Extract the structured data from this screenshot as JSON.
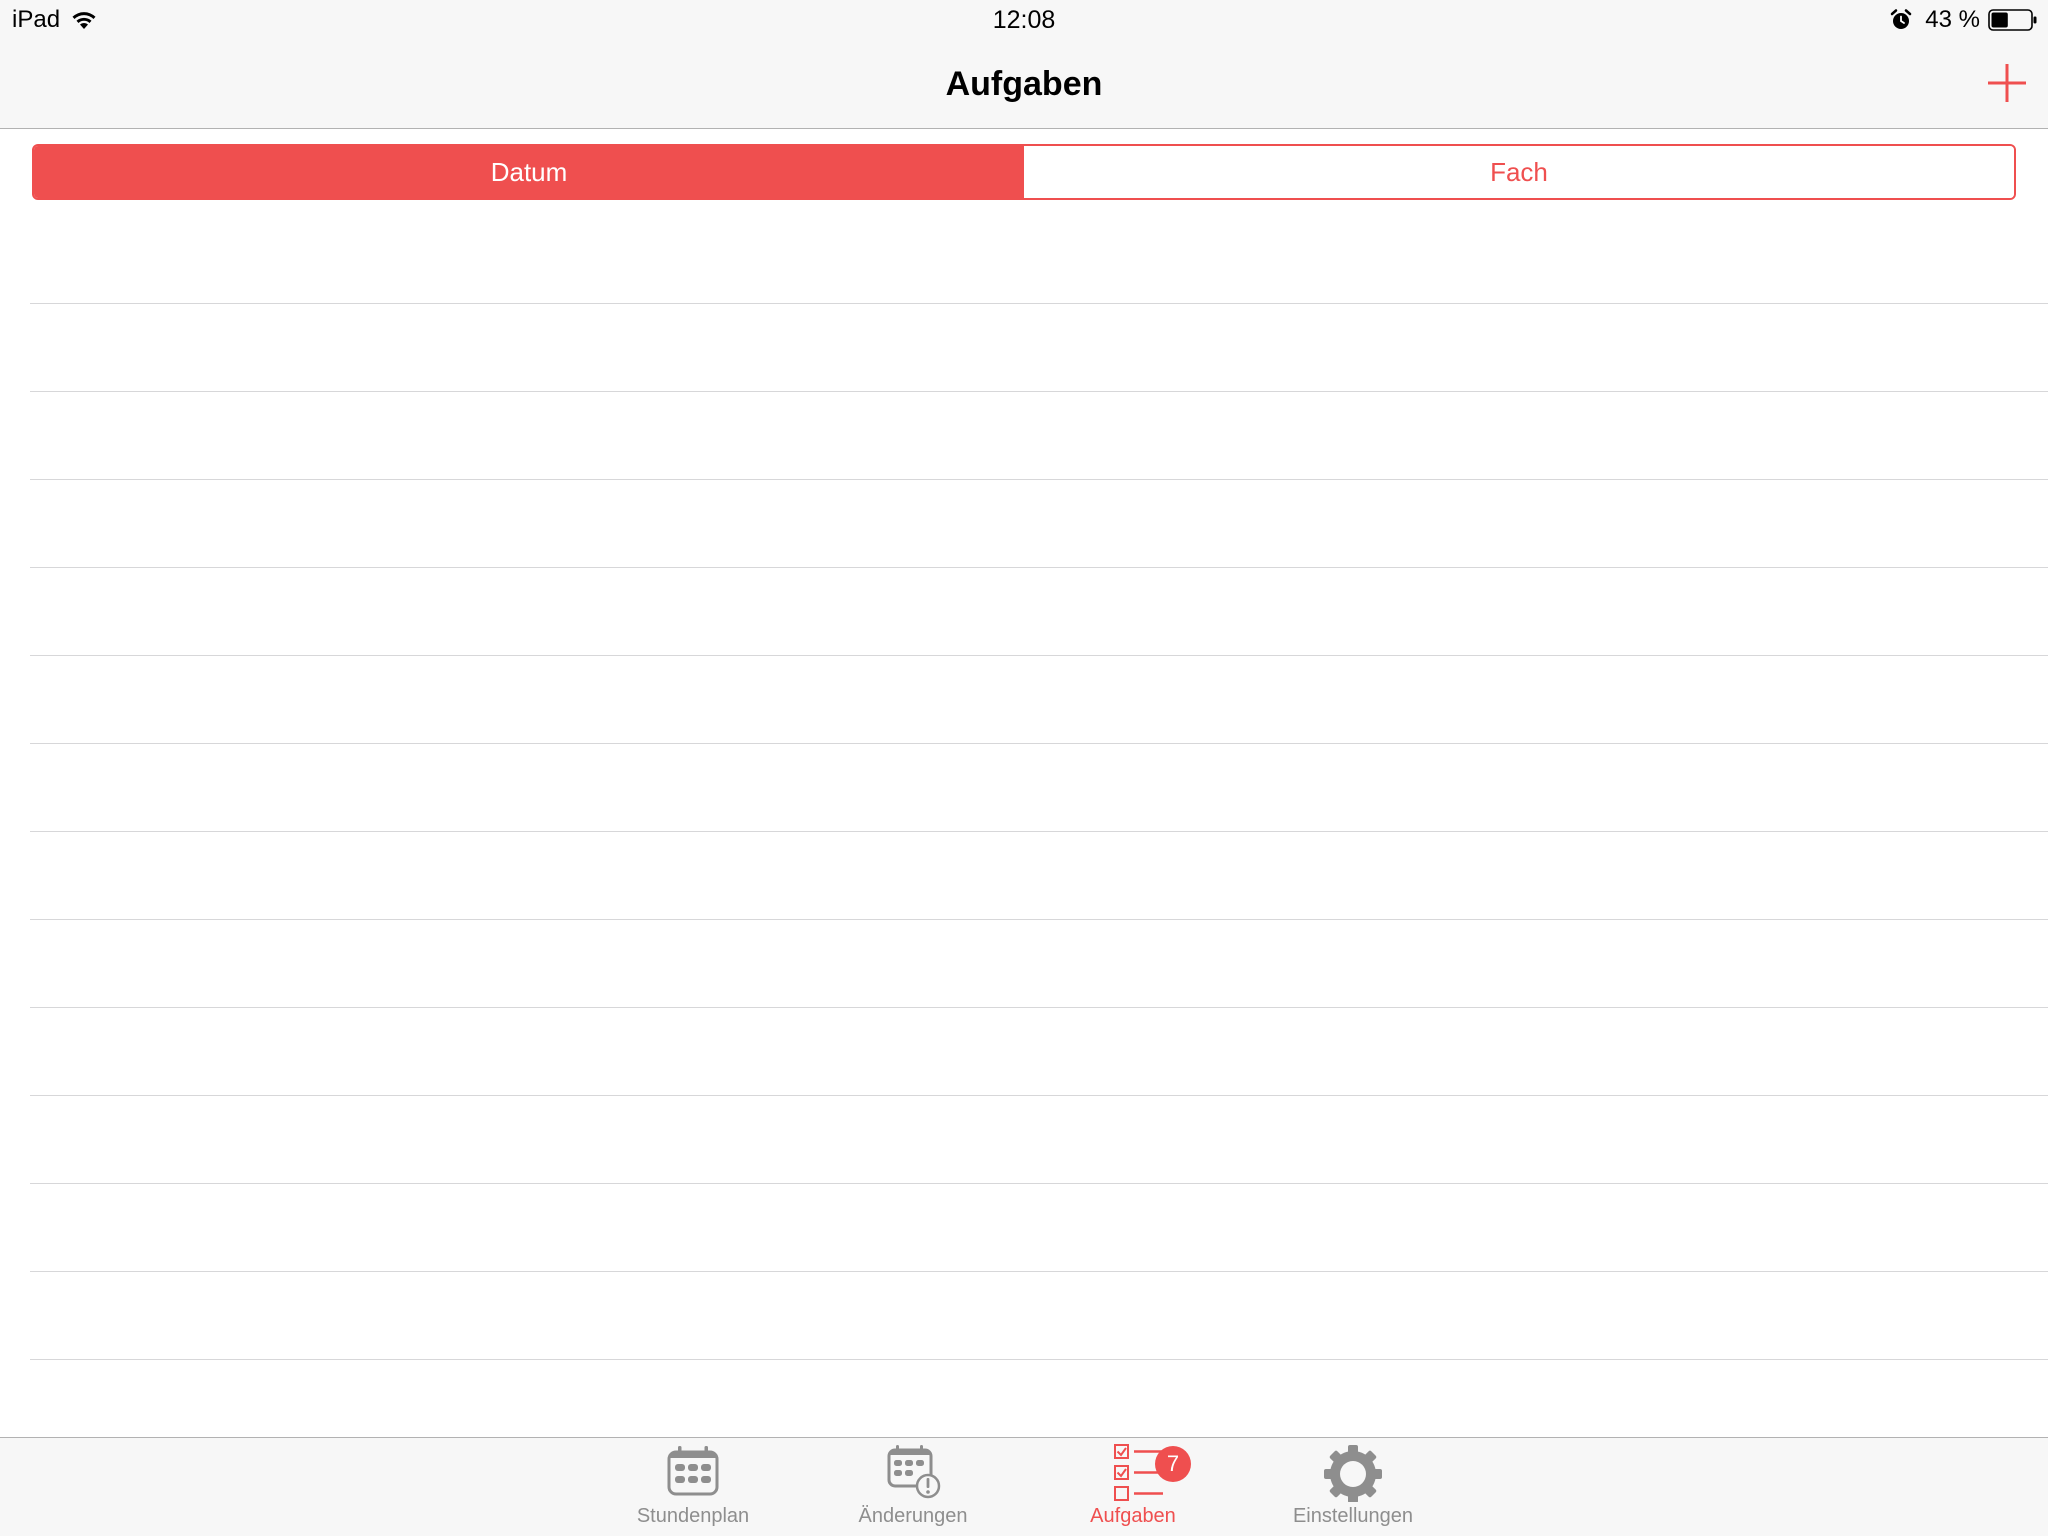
{
  "status_bar": {
    "device": "iPad",
    "time": "12:08",
    "battery": "43 %",
    "battery_level": 0.43
  },
  "nav_bar": {
    "title": "Aufgaben",
    "add_icon": "plus-icon"
  },
  "segmented_control": {
    "segments": [
      {
        "label": "Datum",
        "selected": true
      },
      {
        "label": "Fach",
        "selected": false
      }
    ]
  },
  "tab_bar": {
    "tabs": [
      {
        "label": "Stundenplan",
        "icon": "calendar-grid-icon",
        "selected": false
      },
      {
        "label": "Änderungen",
        "icon": "calendar-alert-icon",
        "selected": false
      },
      {
        "label": "Aufgaben",
        "icon": "checklist-icon",
        "selected": true,
        "badge": "7"
      },
      {
        "label": "Einstellungen",
        "icon": "gear-icon",
        "selected": false
      }
    ]
  },
  "colors": {
    "accent": "#ef4f4f",
    "bar_background": "#f7f7f7",
    "inactive_tab": "#8e8e8e",
    "separator": "#d7d7d9"
  }
}
